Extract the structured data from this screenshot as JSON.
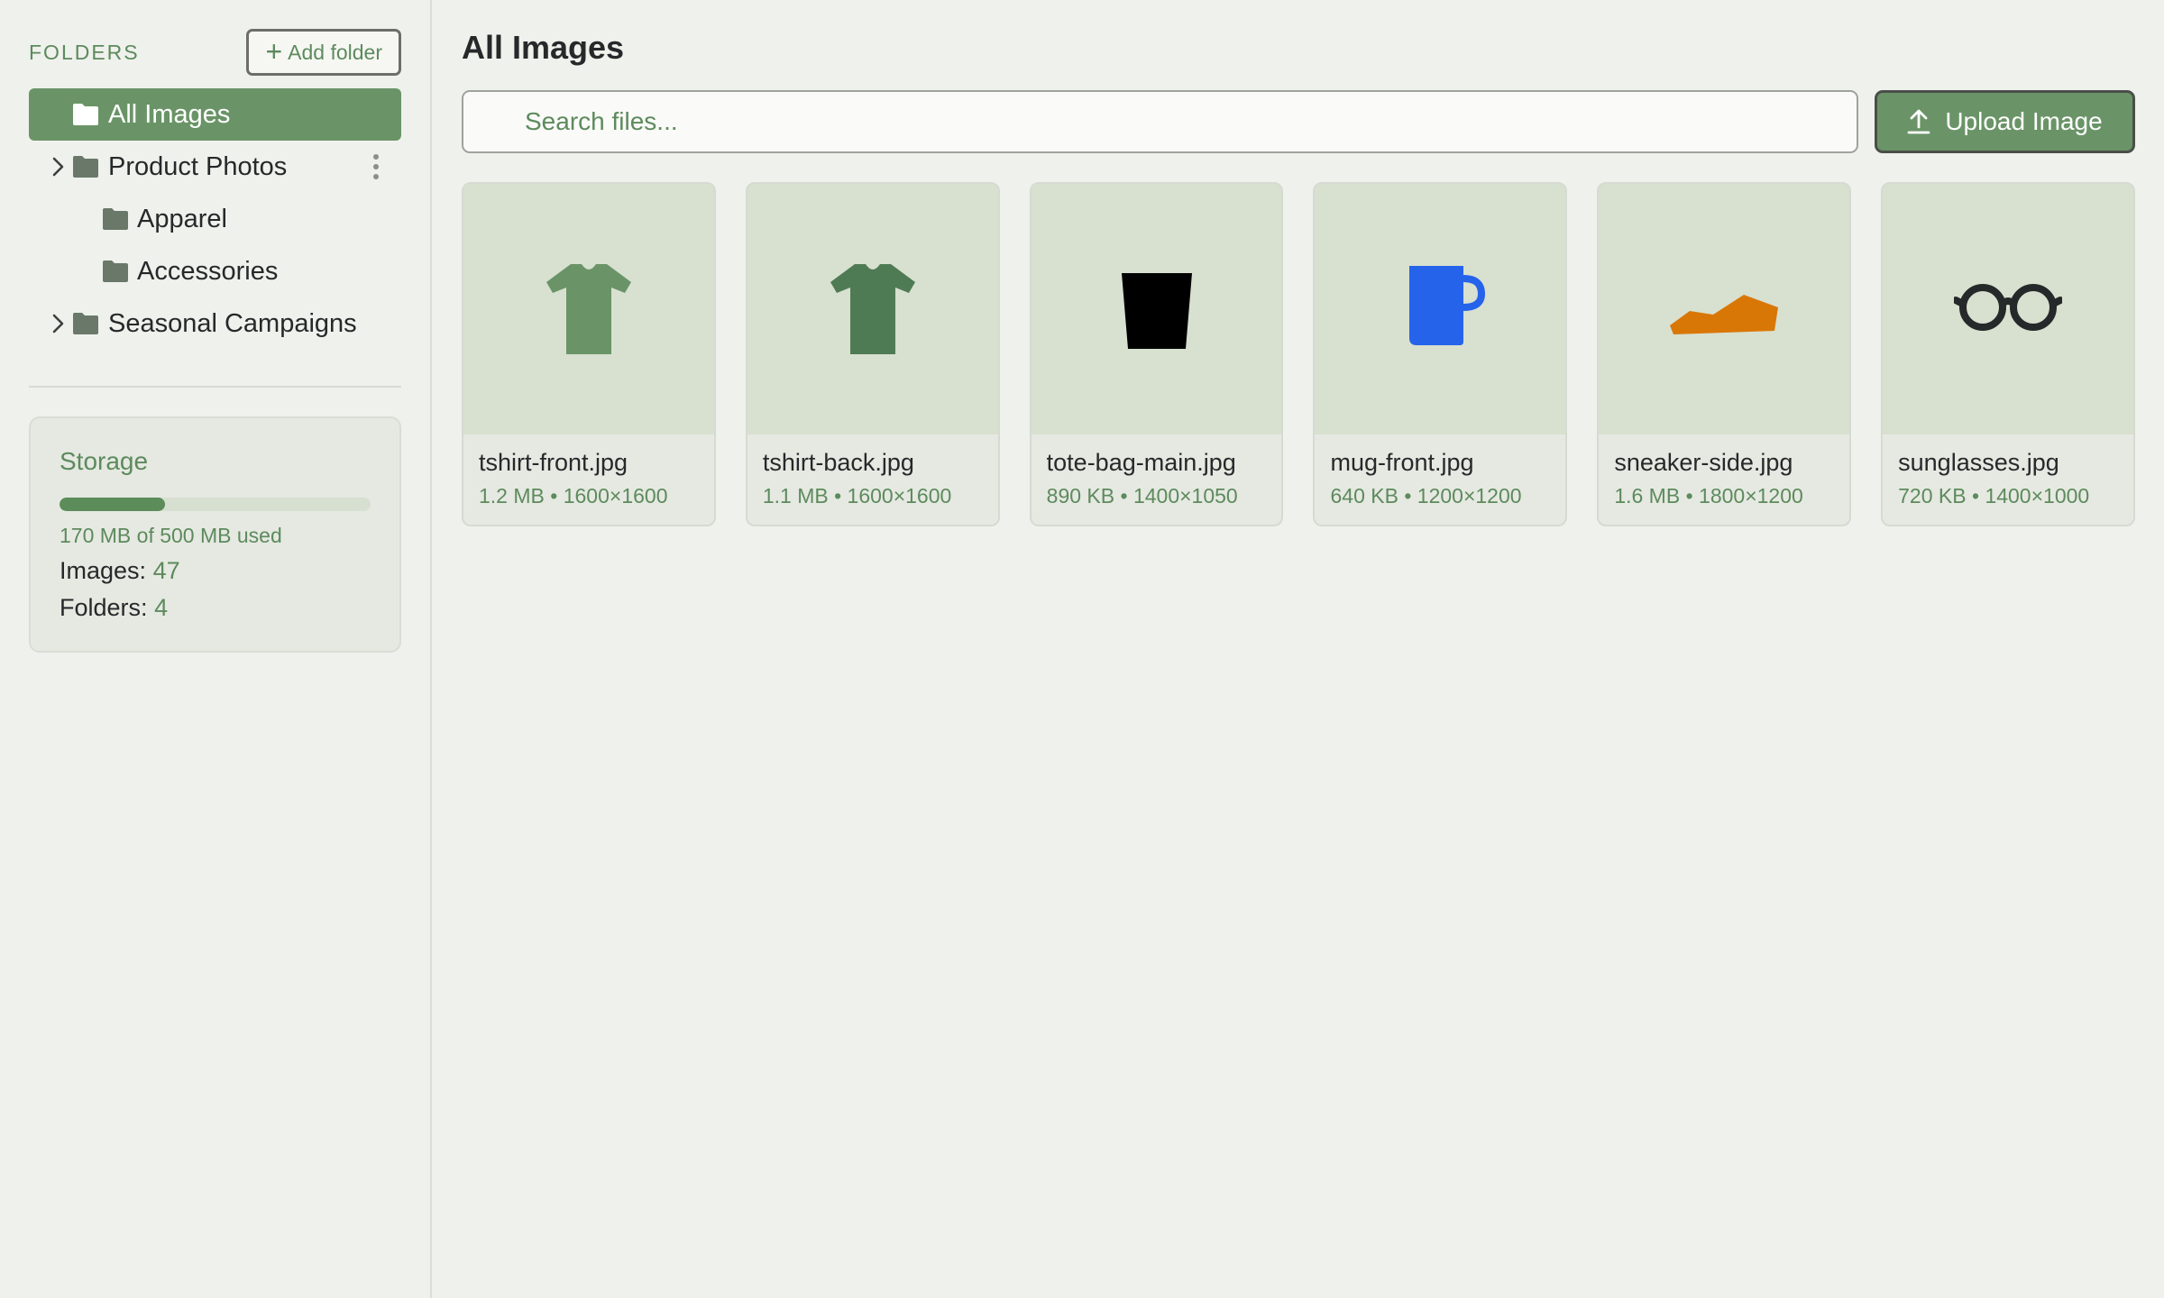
{
  "sidebar": {
    "folders_title": "FOLDERS",
    "add_folder_label": "Add folder",
    "folders": [
      {
        "label": "All Images",
        "active": true
      },
      {
        "label": "Product Photos"
      },
      {
        "label": "Apparel"
      },
      {
        "label": "Accessories"
      },
      {
        "label": "Seasonal Campaigns"
      }
    ],
    "storage": {
      "title": "Storage",
      "used_fraction": 0.34,
      "used_text": "170 MB of 500 MB used",
      "images_label": "Images:",
      "images_count": "47",
      "folders_label": "Folders:",
      "folders_count": "4"
    }
  },
  "main": {
    "title": "All Images",
    "search_placeholder": "Search files...",
    "upload_label": "Upload Image",
    "files": [
      {
        "name": "tshirt-front.jpg",
        "size": "1.2 MB",
        "dims": "1600×1600",
        "icon": "tshirt-icon",
        "color": "#6a9467"
      },
      {
        "name": "tshirt-back.jpg",
        "size": "1.1 MB",
        "dims": "1600×1600",
        "icon": "tshirt-icon",
        "color": "#4f7b54"
      },
      {
        "name": "tote-bag-main.jpg",
        "size": "890 KB",
        "dims": "1400×1050",
        "icon": "tote-bag-icon",
        "color": "#000000"
      },
      {
        "name": "mug-front.jpg",
        "size": "640 KB",
        "dims": "1200×1200",
        "icon": "mug-icon",
        "color": "#2563eb"
      },
      {
        "name": "sneaker-side.jpg",
        "size": "1.6 MB",
        "dims": "1800×1200",
        "icon": "sneaker-icon",
        "color": "#d97706"
      },
      {
        "name": "sunglasses.jpg",
        "size": "720 KB",
        "dims": "1400×1000",
        "icon": "sunglasses-icon",
        "color": "#25292a"
      }
    ]
  },
  "colors": {
    "accent": "#6a9467",
    "accent_text": "#5d8a5d",
    "background": "#eff1ec"
  }
}
